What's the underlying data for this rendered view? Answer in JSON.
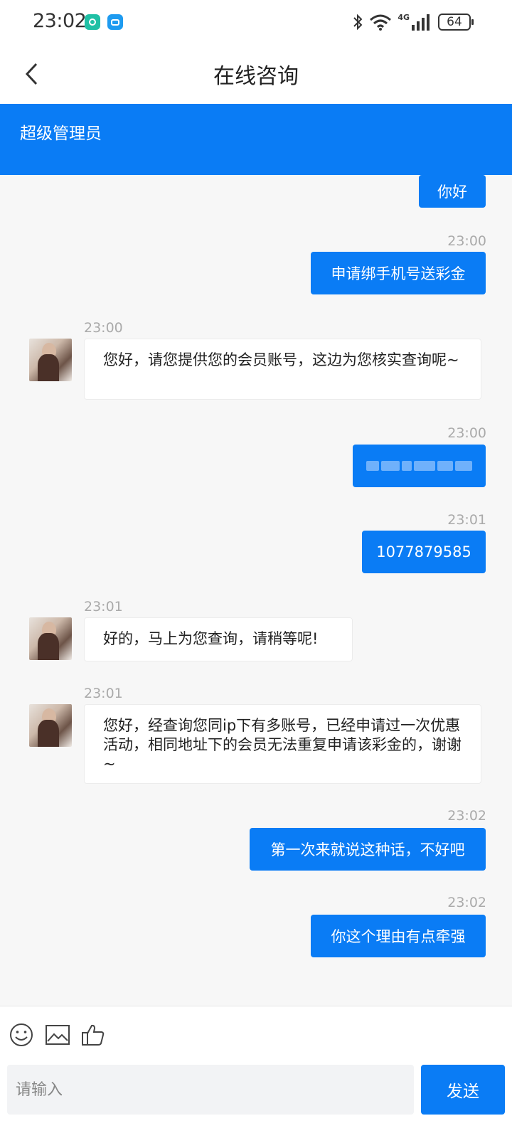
{
  "status_bar": {
    "time": "23:02",
    "battery": "64",
    "network": "4G",
    "icons": [
      "app-notification-icon",
      "message-notification-icon",
      "bluetooth-icon",
      "wifi-icon",
      "signal-icon",
      "battery-icon"
    ]
  },
  "header": {
    "title": "在线咨询",
    "back_icon": "chevron-left-icon"
  },
  "agent": {
    "name": "超级管理员"
  },
  "messages": [
    {
      "side": "out",
      "text": "你好",
      "time": ""
    },
    {
      "side": "out",
      "text": "申请绑手机号送彩金",
      "time": "23:00"
    },
    {
      "side": "in",
      "text": "您好，请您提供您的会员账号，这边为您核实查询呢~",
      "time": "23:00"
    },
    {
      "side": "out",
      "text": "",
      "redacted": true,
      "time": "23:00"
    },
    {
      "side": "out",
      "text": "1077879585",
      "time": "23:01"
    },
    {
      "side": "in",
      "text": "好的，马上为您查询，请稍等呢!",
      "time": "23:01"
    },
    {
      "side": "in",
      "text": "您好，经查询您同ip下有多账号，已经申请过一次优惠活动，相同地址下的会员无法重复申请该彩金的，谢谢~",
      "time": "23:01"
    },
    {
      "side": "out",
      "text": "第一次来就说这种话，不好吧",
      "time": "23:02"
    },
    {
      "side": "out",
      "text": "你这个理由有点牵强",
      "time": "23:02"
    }
  ],
  "composer": {
    "placeholder": "请输入",
    "value": "",
    "send_label": "发送",
    "tools": [
      "emoji-icon",
      "image-icon",
      "thumbs-up-icon"
    ]
  },
  "colors": {
    "accent": "#0a7cf5",
    "background": "#f7f7f7",
    "timestamp": "#aaaaaa"
  }
}
